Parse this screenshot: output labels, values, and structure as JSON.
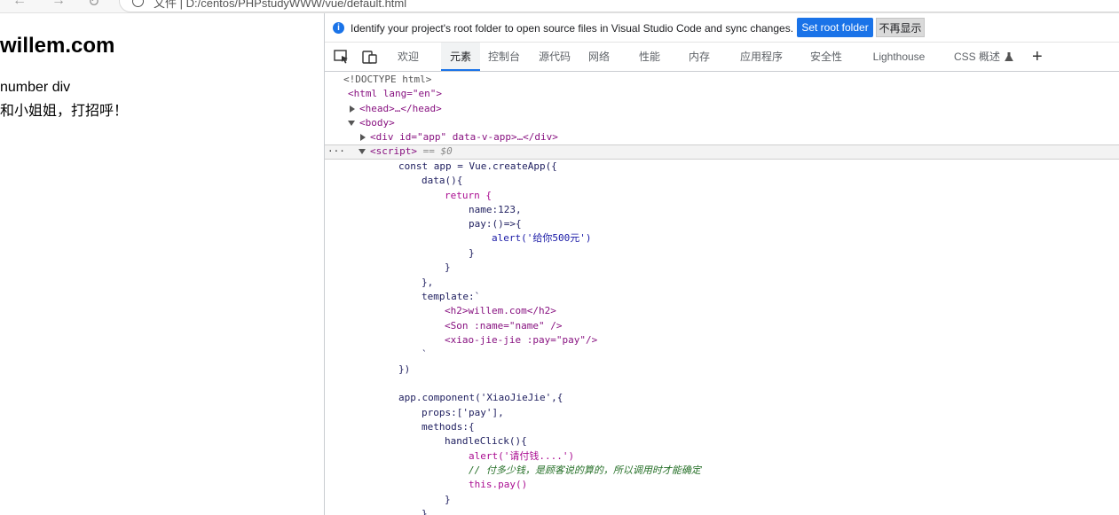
{
  "browser": {
    "address_text": "文件  |  D:/centos/PHPstudyWWW/vue/default.html"
  },
  "page": {
    "heading": "willem.com",
    "line1": "number div",
    "line2": "和小姐姐，打招呼！"
  },
  "devtools": {
    "infobar": {
      "message": "Identify your project's root folder to open source files in Visual Studio Code and sync changes.",
      "set_root_label": "Set root folder",
      "dont_show_label": "不再显示"
    },
    "tabs": [
      "欢迎",
      "元素",
      "控制台",
      "源代码",
      "网络",
      "性能",
      "内存",
      "应用程序",
      "安全性",
      "Lighthouse",
      "CSS 概述"
    ],
    "active_tab": "元素",
    "add_tab_label": "+",
    "source": {
      "doctype": "<!DOCTYPE html>",
      "html_open": "<html lang=\"en\">",
      "head": "<head>…</head>",
      "body_open": "<body>",
      "div_app": "<div id=\"app\" data-v-app>…</div>",
      "script_open": "<script>",
      "script_marker": "== $0",
      "dots": "···",
      "code": [
        "const app = Vue.createApp({",
        "data(){",
        "return {",
        "name:123,",
        "pay:()=>{",
        "alert('给你500元')",
        "}",
        "}",
        "},",
        "template:`",
        "<h2>willem.com</h2>",
        "<Son :name=\"name\" />",
        "<xiao-jie-jie :pay=\"pay\"/>",
        "`",
        "})",
        "",
        "app.component('XiaoJieJie',{",
        "props:['pay'],",
        "methods:{",
        "handleClick(){",
        "alert('请付钱....')",
        "// 付多少钱，是顾客说的算的，所以调用时才能确定",
        "this.pay()",
        "}",
        "}"
      ]
    }
  },
  "colors": {
    "accent": "#1a73e8",
    "tag": "#881280",
    "attr": "#994500",
    "value": "#1a1aa6",
    "comment": "#236e25"
  }
}
